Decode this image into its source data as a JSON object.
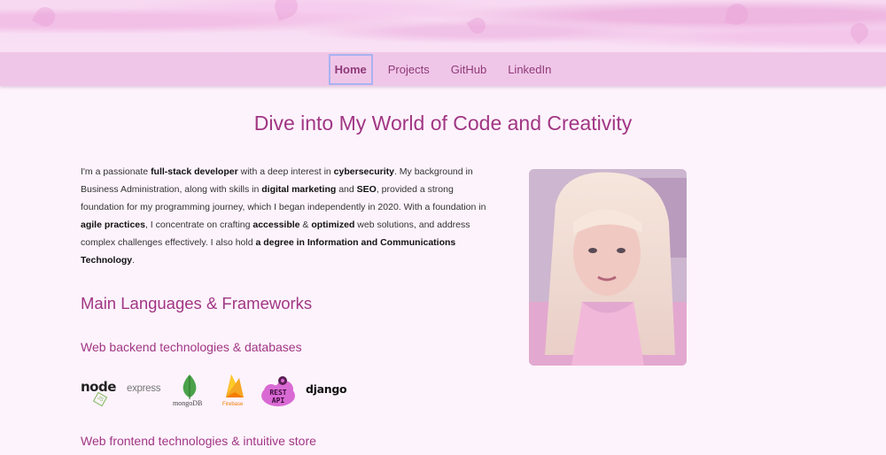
{
  "nav": {
    "items": [
      {
        "label": "Home",
        "active": true
      },
      {
        "label": "Projects",
        "active": false
      },
      {
        "label": "GitHub",
        "active": false
      },
      {
        "label": "LinkedIn",
        "active": false
      }
    ]
  },
  "main": {
    "title": "Dive into My World of Code and Creativity",
    "bio": {
      "p1": "I'm a passionate ",
      "b1": "full-stack developer",
      "p2": " with a deep interest in ",
      "b2": "cybersecurity",
      "p3": ". My background in Business Administration, along with skills in ",
      "b3": "digital marketing",
      "p4": " and ",
      "b4": "SEO",
      "p5": ", provided a strong foundation for my programming journey, which I began independently in 2020. With a foundation in ",
      "b5": "agile practices",
      "p6": ", I concentrate on crafting ",
      "b6": "accessible",
      "p7": " & ",
      "b7": "optimized",
      "p8": " web solutions, and address complex challenges effectively. I also hold ",
      "b8": "a degree in Information and Communications Technology",
      "p9": "."
    },
    "languages_title": "Main Languages & Frameworks",
    "backend_title": "Web backend technologies & databases",
    "frontend_title": "Web frontend technologies & intuitive store",
    "backend_logos": {
      "node": "node",
      "node_sub": "JS",
      "express": "express",
      "mongo": "mongoDB",
      "firebase": "Firebase",
      "rest_1": "REST",
      "rest_2": "API",
      "django": "django"
    }
  },
  "icons": {
    "photo": "profile-photo",
    "node": "nodejs-logo",
    "express": "express-logo",
    "mongo": "mongodb-logo",
    "firebase": "firebase-logo",
    "rest": "rest-api-logo",
    "django": "django-logo"
  },
  "colors": {
    "accent": "#a13684",
    "nav_bg": "#f0c6e8",
    "page_bg": "#fdf3fc"
  }
}
